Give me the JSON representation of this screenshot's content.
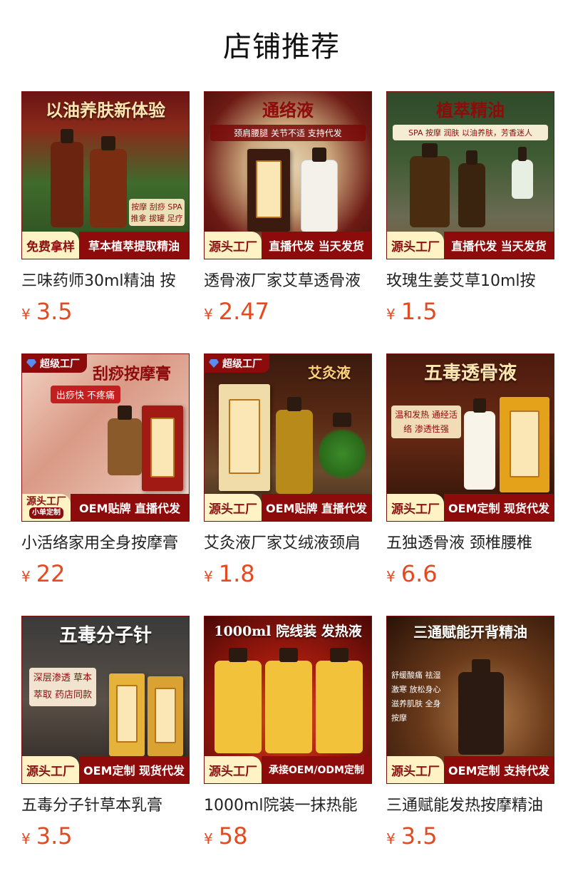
{
  "page_title": "店铺推荐",
  "colors": {
    "price": "#e44a1f",
    "badge_red": "#8e0b0b",
    "badge_cream": "#fff2c4"
  },
  "currency": "¥",
  "products": [
    {
      "name": "三味药师30ml精油 按",
      "price": "3.5",
      "image": {
        "headline": "以油养肤新体验",
        "subline": "按摩 刮痧 SPA 推拿 拔罐 足疗",
        "badge_left": "免费拿样",
        "badge_right": "草本植萃提取精油",
        "top_tag": "",
        "theme": "green"
      }
    },
    {
      "name": "透骨液厂家艾草透骨液",
      "price": "2.47",
      "image": {
        "headline": "通络液",
        "subline": "颈肩腰腿 关节不适 支持代发",
        "badge_left": "源头工厂",
        "badge_right": "直播代发 当天发货",
        "top_tag": "",
        "theme": "wood"
      }
    },
    {
      "name": "玫瑰生姜艾草10ml按",
      "price": "1.5",
      "image": {
        "headline": "植萃精油",
        "subline": "SPA 按摩 润肤 以油养肤，芳香迷人",
        "badge_left": "源头工厂",
        "badge_right": "直播代发 当天发货",
        "top_tag": "",
        "theme": "forest"
      }
    },
    {
      "name": "小活络家用全身按摩膏",
      "price": "22",
      "image": {
        "headline": "刮痧按摩膏",
        "subline": "出痧快 不疼痛",
        "badge_left": "源头工厂",
        "badge_left_small": "小单定制",
        "badge_right": "OEM贴牌 直播代发",
        "top_tag": "超级工厂",
        "theme": "skin"
      }
    },
    {
      "name": "艾灸液厂家艾绒液颈肩",
      "price": "1.8",
      "image": {
        "headline": "艾灸液",
        "subline": "",
        "badge_left": "源头工厂",
        "badge_right": "OEM贴牌 直播代发",
        "top_tag": "超级工厂",
        "theme": "herb"
      }
    },
    {
      "name": "五独透骨液 颈椎腰椎",
      "price": "6.6",
      "image": {
        "headline": "五毒透骨液",
        "subline": "温和发热 通经活络 渗透性强",
        "badge_left": "源头工厂",
        "badge_right": "OEM定制 现货代发",
        "top_tag": "",
        "theme": "brown"
      }
    },
    {
      "name": "五毒分子针草本乳膏",
      "price": "3.5",
      "image": {
        "headline": "五毒分子针",
        "subline": "深层渗透 草本萃取 药店同款",
        "badge_left": "源头工厂",
        "badge_right": "OEM定制 现货代发",
        "top_tag": "",
        "theme": "dark"
      }
    },
    {
      "name": "1000ml院装一抹热能",
      "price": "58",
      "image": {
        "headline": "1000ml 院线装 发热液",
        "subline": "",
        "badge_left": "源头工厂",
        "badge_right": "承接OEM/ODM定制",
        "top_tag": "",
        "theme": "fire"
      }
    },
    {
      "name": "三通赋能发热按摩精油",
      "price": "3.5",
      "image": {
        "headline": "三通赋能开背精油",
        "subline": "舒缓酸痛 祛湿激寒 放松身心 滋养肌肤 全身按摩",
        "badge_left": "源头工厂",
        "badge_right": "OEM定制 支持代发",
        "top_tag": "",
        "theme": "spa"
      }
    }
  ]
}
